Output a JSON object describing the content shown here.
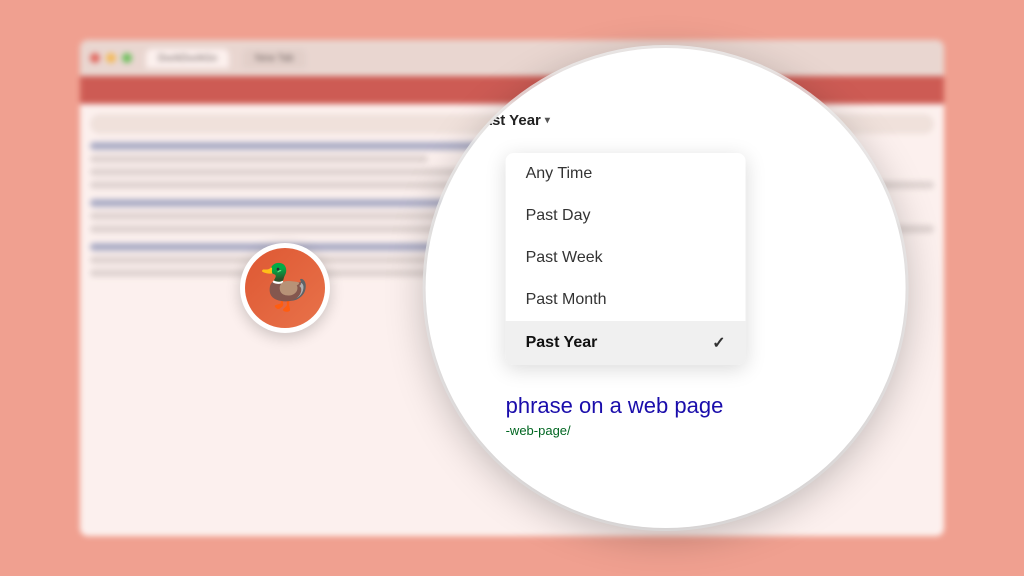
{
  "background": {
    "color": "#f0a090"
  },
  "browser": {
    "tabs": [
      "DuckDuckGo",
      "New Tab"
    ],
    "toolbar_color": "#c8504a"
  },
  "magnifier": {
    "filter_label": "Past Year",
    "chevron": "▼",
    "dropdown": {
      "items": [
        {
          "label": "Any Time",
          "selected": false
        },
        {
          "label": "Past Day",
          "selected": false
        },
        {
          "label": "Past Week",
          "selected": false
        },
        {
          "label": "Past Month",
          "selected": false
        },
        {
          "label": "Past Year",
          "selected": true
        }
      ]
    },
    "result_title": "phrase on a web page",
    "result_url": "-web-page/"
  },
  "icons": {
    "checkmark": "✓",
    "chevron_down": "▾"
  }
}
